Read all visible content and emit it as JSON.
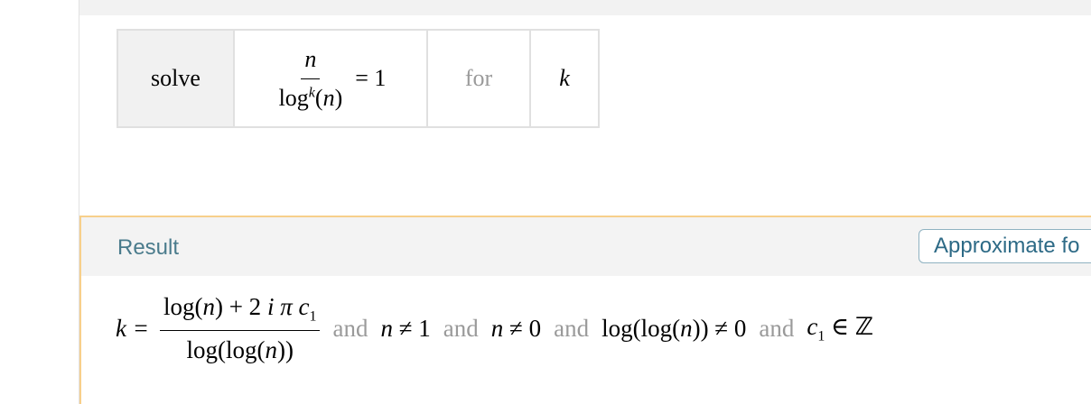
{
  "input": {
    "command": "solve",
    "equation": {
      "numerator": "n",
      "denominator_fn": "log",
      "denominator_exp": "k",
      "denominator_arg": "(n)",
      "rhs": "= 1"
    },
    "for_label": "for",
    "variable": "k"
  },
  "result": {
    "title": "Result",
    "approx_button_label": "Approximate fo",
    "lhs": "k =",
    "fraction": {
      "numerator_pre": "log(",
      "numerator_var": "n",
      "numerator_post": ") + 2",
      "numerator_i": "i",
      "numerator_pi": "π",
      "numerator_c": "c",
      "numerator_c_sub": "1",
      "denominator_pre": "log(log(",
      "denominator_var": "n",
      "denominator_post": "))"
    },
    "and_1": "and",
    "cond_1_var": "n",
    "cond_1_rest": "≠ 1",
    "and_2": "and",
    "cond_2_var": "n",
    "cond_2_rest": "≠ 0",
    "and_3": "and",
    "cond_3_pre": "log(log(",
    "cond_3_var": "n",
    "cond_3_post": ")) ≠ 0",
    "and_4": "and",
    "cond_4_var": "c",
    "cond_4_sub": "1",
    "cond_4_rel": "∈",
    "cond_4_set": "ℤ"
  },
  "colors": {
    "result_border": "#f7cf8b",
    "result_title": "#4a7b8c",
    "button_text": "#2d6a86",
    "muted_text": "#9a9a9a"
  }
}
